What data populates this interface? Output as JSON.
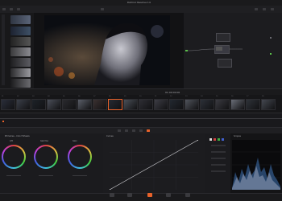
{
  "app": {
    "title": "DaVinci Resolve 14",
    "status": "Edited"
  },
  "viewer": {
    "timecode": "01:00:00:00"
  },
  "gallery": {
    "item_count": 8
  },
  "timeline": {
    "clips": [
      "01",
      "02",
      "03",
      "04",
      "05",
      "06",
      "07",
      "08",
      "09",
      "10",
      "11",
      "12",
      "13",
      "14",
      "15",
      "16",
      "17",
      "18"
    ]
  },
  "color_wheels": {
    "labels": [
      "Lift",
      "Gamma",
      "Gain"
    ],
    "mode": "Primaries - Color Wheels"
  },
  "curves": {
    "label": "Curves"
  },
  "scopes": {
    "label": "Scopes"
  },
  "page_tabs": [
    "Media",
    "Edit",
    "Color",
    "Fairlight",
    "Deliver"
  ],
  "active_page": "Color",
  "colors": {
    "accent": "#e8622a",
    "panel": "#1d1d20",
    "background": "#141416"
  }
}
